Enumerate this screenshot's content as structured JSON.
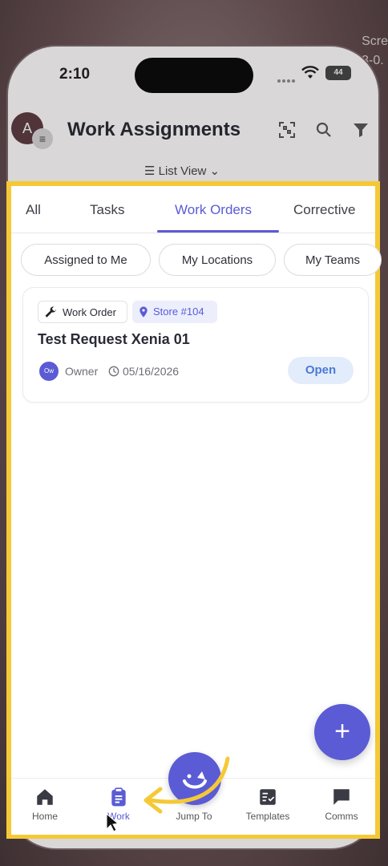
{
  "background": {
    "side_text_1": "Scre",
    "side_text_2": "3-0."
  },
  "status_bar": {
    "time": "2:10",
    "battery": "44"
  },
  "header": {
    "avatar_initial": "A",
    "title": "Work Assignments",
    "view_selector": "List View"
  },
  "tabs": [
    {
      "label": "All"
    },
    {
      "label": "Tasks"
    },
    {
      "label": "Work Orders",
      "active": true
    },
    {
      "label": "Corrective"
    }
  ],
  "filters": [
    {
      "label": "Assigned to Me"
    },
    {
      "label": "My Locations"
    },
    {
      "label": "My Teams"
    }
  ],
  "card": {
    "type_badge": "Work Order",
    "location_badge": "Store #104",
    "title": "Test Request Xenia 01",
    "owner_initials": "Ow",
    "owner_label": "Owner",
    "date": "05/16/2026",
    "status": "Open"
  },
  "fab": {
    "label": "+"
  },
  "bottom_nav": [
    {
      "label": "Home",
      "icon": "home-icon"
    },
    {
      "label": "Work",
      "icon": "clipboard-icon",
      "active": true
    },
    {
      "label": "Jump To",
      "icon": "jump-icon"
    },
    {
      "label": "Templates",
      "icon": "templates-icon"
    },
    {
      "label": "Comms",
      "icon": "chat-icon"
    }
  ],
  "colors": {
    "accent": "#5b5bd6",
    "highlight_border": "#f5c936",
    "status_open_bg": "#e3ecfa",
    "status_open_text": "#4a7ad6"
  }
}
